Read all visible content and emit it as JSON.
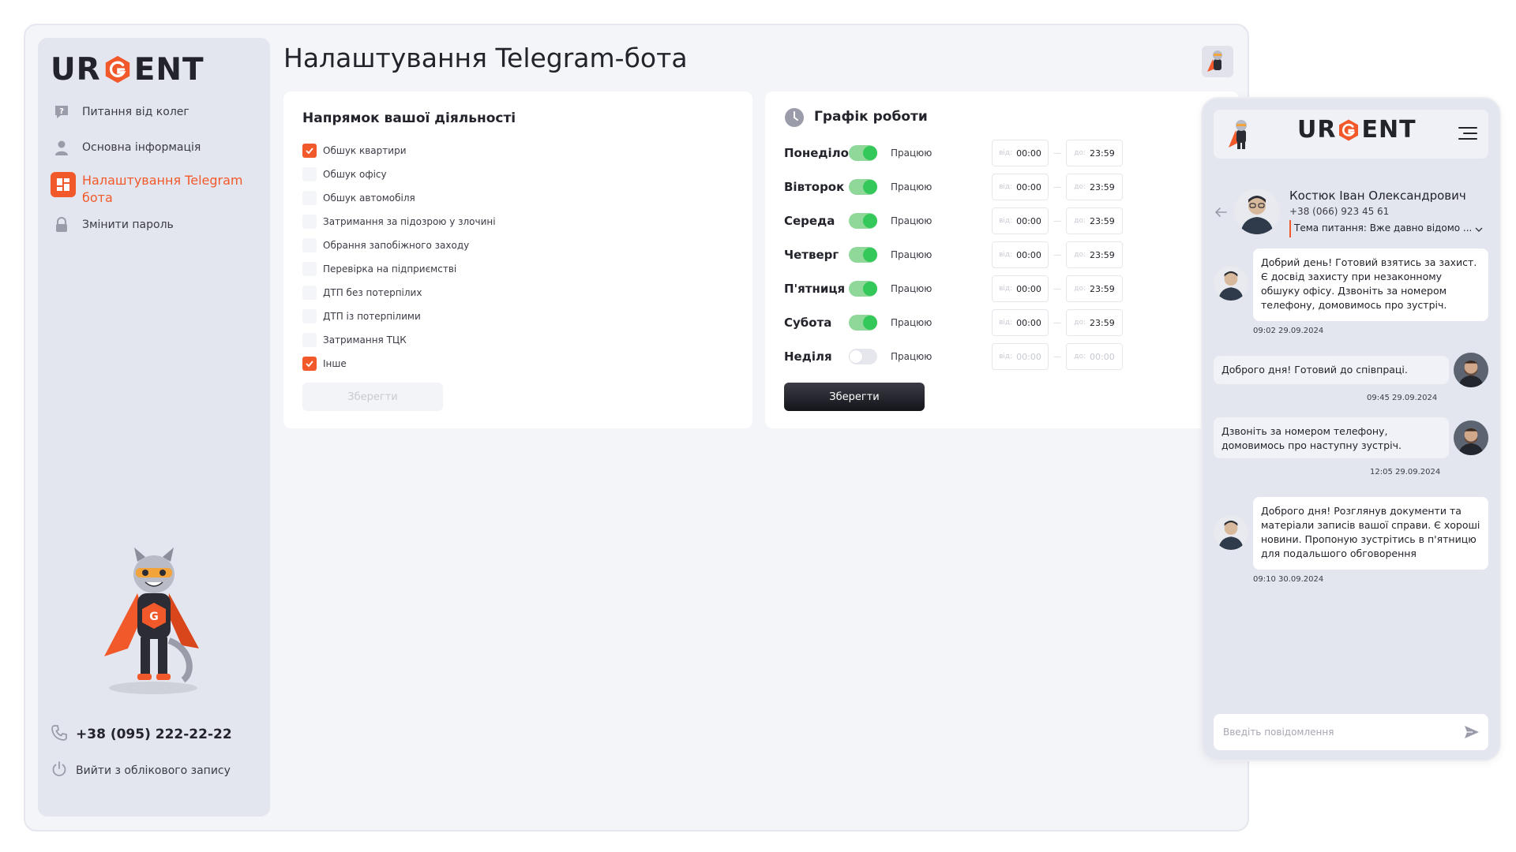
{
  "brand": {
    "logo_left": "UR",
    "logo_right": "ENT",
    "accent": "#f2592a"
  },
  "sidebar": {
    "items": [
      {
        "label": "Питання від колег",
        "icon": "question-icon",
        "active": false
      },
      {
        "label": "Основна інформація",
        "icon": "user-icon",
        "active": false
      },
      {
        "label": "Налаштування Telegram бота",
        "icon": "dashboard-icon",
        "active": true
      },
      {
        "label": "Змінити пароль",
        "icon": "lock-icon",
        "active": false
      }
    ],
    "phone": "+38 (095) 222-22-22",
    "logout": "Вийти з облікового запису"
  },
  "page": {
    "title": "Налаштування Telegram-бота"
  },
  "activity": {
    "title": "Напрямок вашої діяльності",
    "items": [
      {
        "label": "Обшук квартири",
        "checked": true
      },
      {
        "label": "Обшук офісу",
        "checked": false
      },
      {
        "label": "Обшук автомобіля",
        "checked": false
      },
      {
        "label": "Затримання за підозрою у злочині",
        "checked": false
      },
      {
        "label": "Обрання запобіжного заходу",
        "checked": false
      },
      {
        "label": "Перевірка на підприємстві",
        "checked": false
      },
      {
        "label": "ДТП без потерпілих",
        "checked": false
      },
      {
        "label": "ДТП із потерпілими",
        "checked": false
      },
      {
        "label": "Затримання ТЦК",
        "checked": false
      },
      {
        "label": "Інше",
        "checked": true
      }
    ],
    "save_label": "Зберегти"
  },
  "schedule": {
    "title": "Графік роботи",
    "from_prefix": "від:",
    "to_prefix": "до:",
    "days": [
      {
        "day": "Понеділок",
        "on": true,
        "status": "Працюю",
        "from": "00:00",
        "to": "23:59"
      },
      {
        "day": "Вівторок",
        "on": true,
        "status": "Працюю",
        "from": "00:00",
        "to": "23:59"
      },
      {
        "day": "Середа",
        "on": true,
        "status": "Працюю",
        "from": "00:00",
        "to": "23:59"
      },
      {
        "day": "Четверг",
        "on": true,
        "status": "Працюю",
        "from": "00:00",
        "to": "23:59"
      },
      {
        "day": "П'ятниця",
        "on": true,
        "status": "Працюю",
        "from": "00:00",
        "to": "23:59"
      },
      {
        "day": "Субота",
        "on": true,
        "status": "Працюю",
        "from": "00:00",
        "to": "23:59"
      },
      {
        "day": "Неділя",
        "on": false,
        "status": "Працюю",
        "from": "00:00",
        "to": "00:00"
      }
    ],
    "save_label": "Зберегти"
  },
  "chat": {
    "contact": {
      "name": "Костюк Іван Олександрович",
      "phone": "+38 (066) 923 45 61",
      "topic": "Тема питання: Вже давно відомо ..."
    },
    "messages": [
      {
        "from": "them",
        "text": "Добрий день! Готовий взятись за захист. Є досвід захисту при незаконному обшуку офісу. Дзвоніть за номером телефону, домовимось про зустріч.",
        "time": "09:02 29.09.2024"
      },
      {
        "from": "me",
        "text": "Доброго дня! Готовий до співпраці.",
        "time": "09:45 29.09.2024"
      },
      {
        "from": "me",
        "text": "Дзвоніть за номером телефону, домовимось про наступну зустріч.",
        "time": "12:05 29.09.2024"
      },
      {
        "from": "them",
        "text": "Доброго дня! Розглянув документи та матеріали записів вашої справи. Є хороші новини. Пропоную зустрітись в п'ятницю для подальшого обговорення",
        "time": "09:10 30.09.2024"
      }
    ],
    "input_placeholder": "Введіть повідомлення"
  }
}
